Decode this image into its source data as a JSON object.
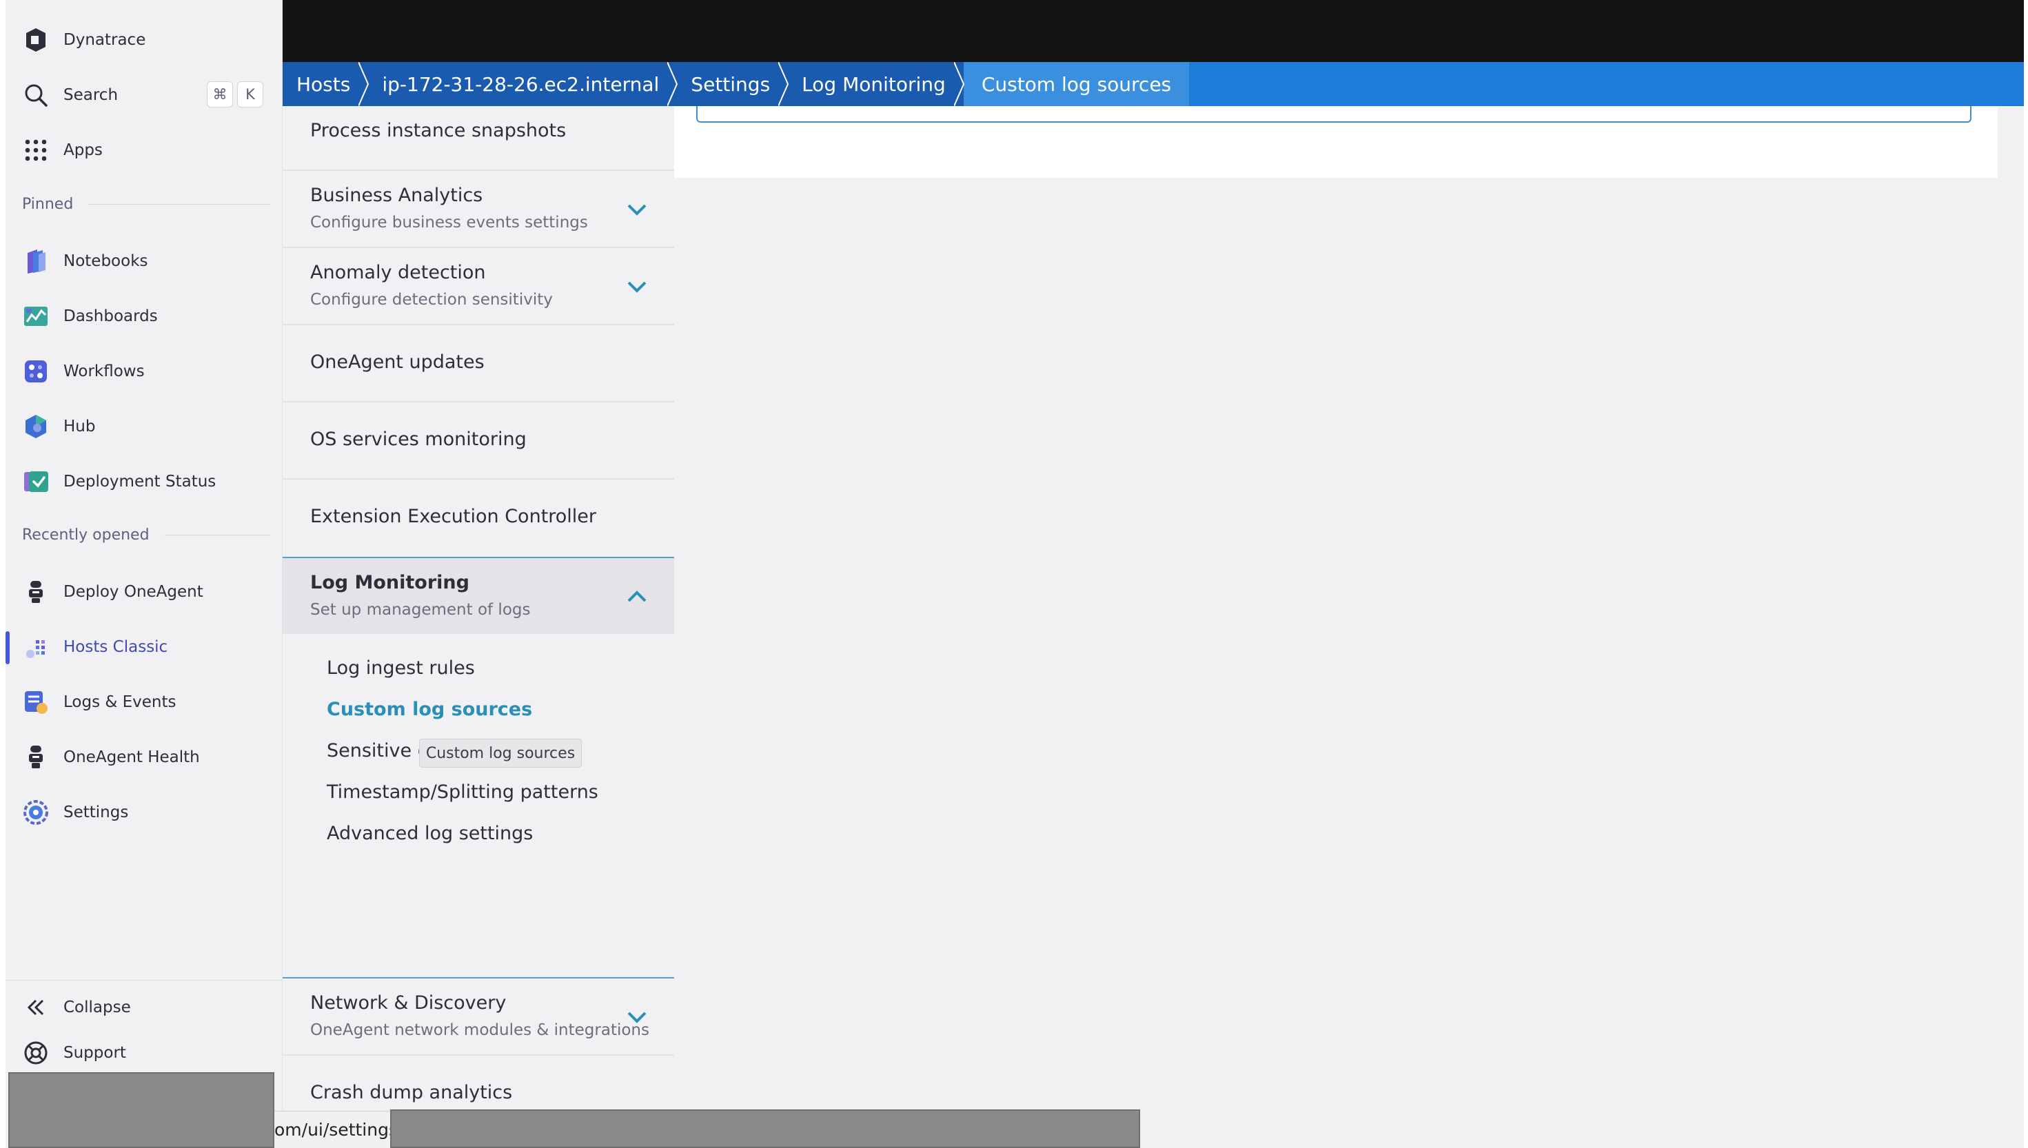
{
  "sidebar": {
    "brand": "Dynatrace",
    "search_label": "Search",
    "search_shortcut": [
      "⌘",
      "K"
    ],
    "apps_label": "Apps",
    "pinned_label": "Pinned",
    "pinned": [
      {
        "label": "Notebooks",
        "icon": "notebooks-icon"
      },
      {
        "label": "Dashboards",
        "icon": "dashboards-icon"
      },
      {
        "label": "Workflows",
        "icon": "workflows-icon"
      },
      {
        "label": "Hub",
        "icon": "hub-icon"
      },
      {
        "label": "Deployment Status",
        "icon": "deployment-status-icon"
      }
    ],
    "recent_label": "Recently opened",
    "recent": [
      {
        "label": "Deploy OneAgent",
        "icon": "oneagent-icon"
      },
      {
        "label": "Hosts Classic",
        "icon": "hosts-icon",
        "active": true
      },
      {
        "label": "Logs & Events",
        "icon": "logs-icon"
      },
      {
        "label": "OneAgent Health",
        "icon": "oneagent-health-icon"
      },
      {
        "label": "Settings",
        "icon": "settings-gear-icon"
      }
    ],
    "collapse_label": "Collapse",
    "support_label": "Support"
  },
  "breadcrumb": [
    "Hosts",
    "ip-172-31-28-26.ec2.internal",
    "Settings",
    "Log Monitoring",
    "Custom log sources"
  ],
  "settings_menu": {
    "items": [
      {
        "title": "Process instance snapshots"
      },
      {
        "title": "Business Analytics",
        "subtitle": "Configure business events settings"
      },
      {
        "title": "Anomaly detection",
        "subtitle": "Configure detection sensitivity"
      },
      {
        "title": "OneAgent updates"
      },
      {
        "title": "OS services monitoring"
      },
      {
        "title": "Extension Execution Controller"
      }
    ],
    "expanded": {
      "title": "Log Monitoring",
      "subtitle": "Set up management of logs",
      "children": [
        "Log ingest rules",
        "Custom log sources",
        "Sensitive d",
        "Timestamp/Splitting patterns",
        "Advanced log settings"
      ],
      "selected_index": 1
    },
    "after": [
      {
        "title": "Network & Discovery",
        "subtitle": "OneAgent network modules & integrations"
      },
      {
        "title": "Crash dump analytics"
      }
    ],
    "tooltip": "Custom log sources"
  },
  "status_bar": {
    "url_fragment": "om/ui/settings/"
  },
  "colors": {
    "breadcrumb_bg": "#1f7bd8",
    "selected_link": "#2a8fb8",
    "active_nav": "#3d4bb3"
  }
}
